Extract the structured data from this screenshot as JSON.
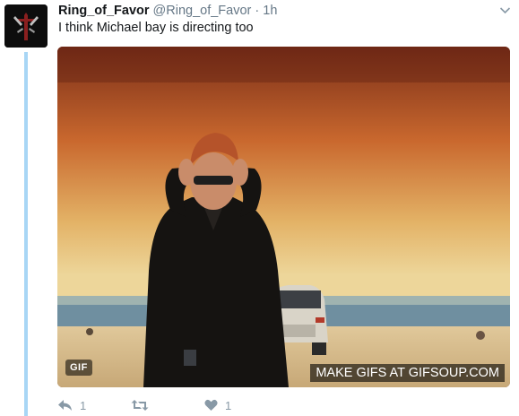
{
  "tweet": {
    "display_name": "Ring_of_Favor",
    "handle": "@Ring_of_Favor",
    "separator": "·",
    "time": "1h",
    "text": "I think Michael bay is directing too"
  },
  "media": {
    "type": "gif",
    "badge": "GIF",
    "watermark": "MAKE GIFS AT GIFSOUP.COM"
  },
  "actions": {
    "reply_count": "1",
    "retweet_count": "",
    "like_count": "1"
  },
  "icons": {
    "avatar": "cross-emblem-icon",
    "menu": "chevron-down-icon",
    "reply": "reply-icon",
    "retweet": "retweet-icon",
    "like": "heart-icon"
  },
  "colors": {
    "text": "#14171a",
    "muted": "#657786",
    "action": "#8899a6",
    "thread_line": "#a8d6f5"
  }
}
